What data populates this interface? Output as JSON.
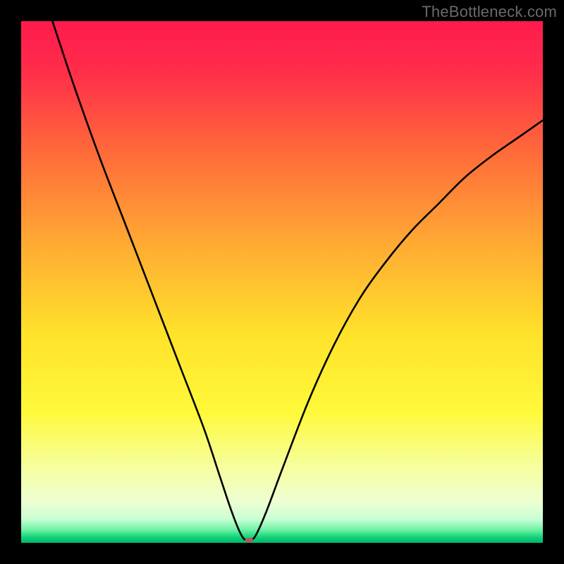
{
  "watermark": "TheBottleneck.com",
  "chart_data": {
    "type": "line",
    "title": "",
    "xlabel": "",
    "ylabel": "",
    "xlim": [
      0,
      100
    ],
    "ylim": [
      0,
      100
    ],
    "gradient_stops": [
      {
        "offset": 0.0,
        "color": "#ff1a4d"
      },
      {
        "offset": 0.1,
        "color": "#ff2e4a"
      },
      {
        "offset": 0.25,
        "color": "#ff6a3a"
      },
      {
        "offset": 0.45,
        "color": "#ffb232"
      },
      {
        "offset": 0.6,
        "color": "#ffe22a"
      },
      {
        "offset": 0.75,
        "color": "#fff93a"
      },
      {
        "offset": 0.85,
        "color": "#f6ff9a"
      },
      {
        "offset": 0.92,
        "color": "#eeffd2"
      },
      {
        "offset": 0.955,
        "color": "#c8ffd4"
      },
      {
        "offset": 0.975,
        "color": "#6cf2a2"
      },
      {
        "offset": 0.99,
        "color": "#0fd178"
      },
      {
        "offset": 1.0,
        "color": "#02b56a"
      }
    ],
    "series": [
      {
        "name": "bottleneck-curve",
        "x": [
          6,
          10,
          15,
          20,
          25,
          30,
          35,
          38,
          40,
          41.5,
          42.5,
          43.2,
          44,
          45,
          47,
          50,
          55,
          60,
          65,
          70,
          75,
          80,
          85,
          90,
          95,
          100
        ],
        "y": [
          100,
          88,
          74,
          61,
          48,
          35,
          22,
          13,
          7,
          3,
          1,
          0.5,
          0.5,
          1.5,
          6,
          14,
          27,
          38,
          47,
          54,
          60,
          65,
          70,
          74,
          77.5,
          81
        ]
      }
    ],
    "marker": {
      "x": 43.7,
      "y": 0.5,
      "color": "#b05a5a",
      "rx": 6,
      "ry": 3.5
    }
  }
}
